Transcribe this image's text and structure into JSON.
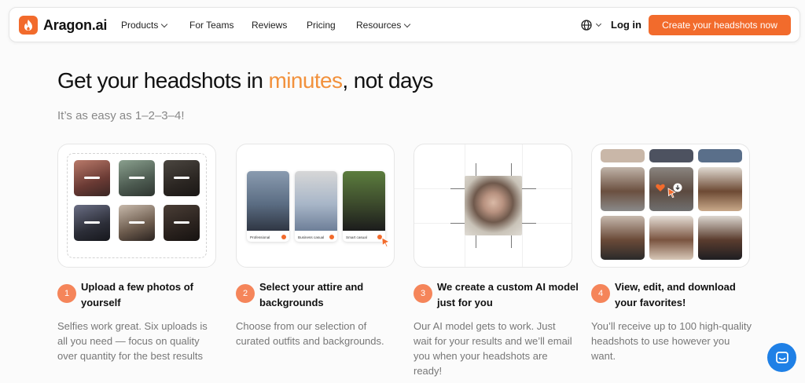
{
  "nav": {
    "brand": "Aragon.ai",
    "items": [
      {
        "label": "Products",
        "dropdown": true
      },
      {
        "label": "For Teams",
        "dropdown": false
      },
      {
        "label": "Reviews",
        "dropdown": false
      },
      {
        "label": "Pricing",
        "dropdown": false
      },
      {
        "label": "Resources",
        "dropdown": true
      }
    ],
    "login_label": "Log in",
    "cta_label": "Create your headshots now"
  },
  "hero": {
    "title_before": "Get your headshots in ",
    "title_highlight": "minutes",
    "title_after": ", not days",
    "subtitle": "It’s as easy as 1–2–3–4!"
  },
  "outfits": [
    {
      "label": "Professional"
    },
    {
      "label": "Business casual"
    },
    {
      "label": "Smart casual"
    }
  ],
  "steps": [
    {
      "number": "1",
      "title": "Upload a few photos of yourself",
      "desc": "Selfies work great. Six uploads is all you need — focus on quality over quantity for the best results"
    },
    {
      "number": "2",
      "title": "Select your attire and backgrounds",
      "desc": "Choose from our selection of curated outfits and backgrounds."
    },
    {
      "number": "3",
      "title": "We create a custom AI model just for you",
      "desc": "Our AI model gets to work. Just wait for your results and we’ll email you when your headshots are ready!"
    },
    {
      "number": "4",
      "title": "View, edit, and download your favorites!",
      "desc": "You’ll receive up to 100 high-quality headshots to use however you want."
    }
  ],
  "colors": {
    "accent": "#f26b2c",
    "highlight": "#f2913c",
    "step_badge": "#f5855a",
    "chat": "#1f80e6"
  },
  "icons": [
    "flame-logo-icon",
    "chevron-down-icon",
    "globe-icon",
    "check-icon",
    "cursor-icon",
    "heart-icon",
    "download-icon",
    "chat-icon"
  ]
}
